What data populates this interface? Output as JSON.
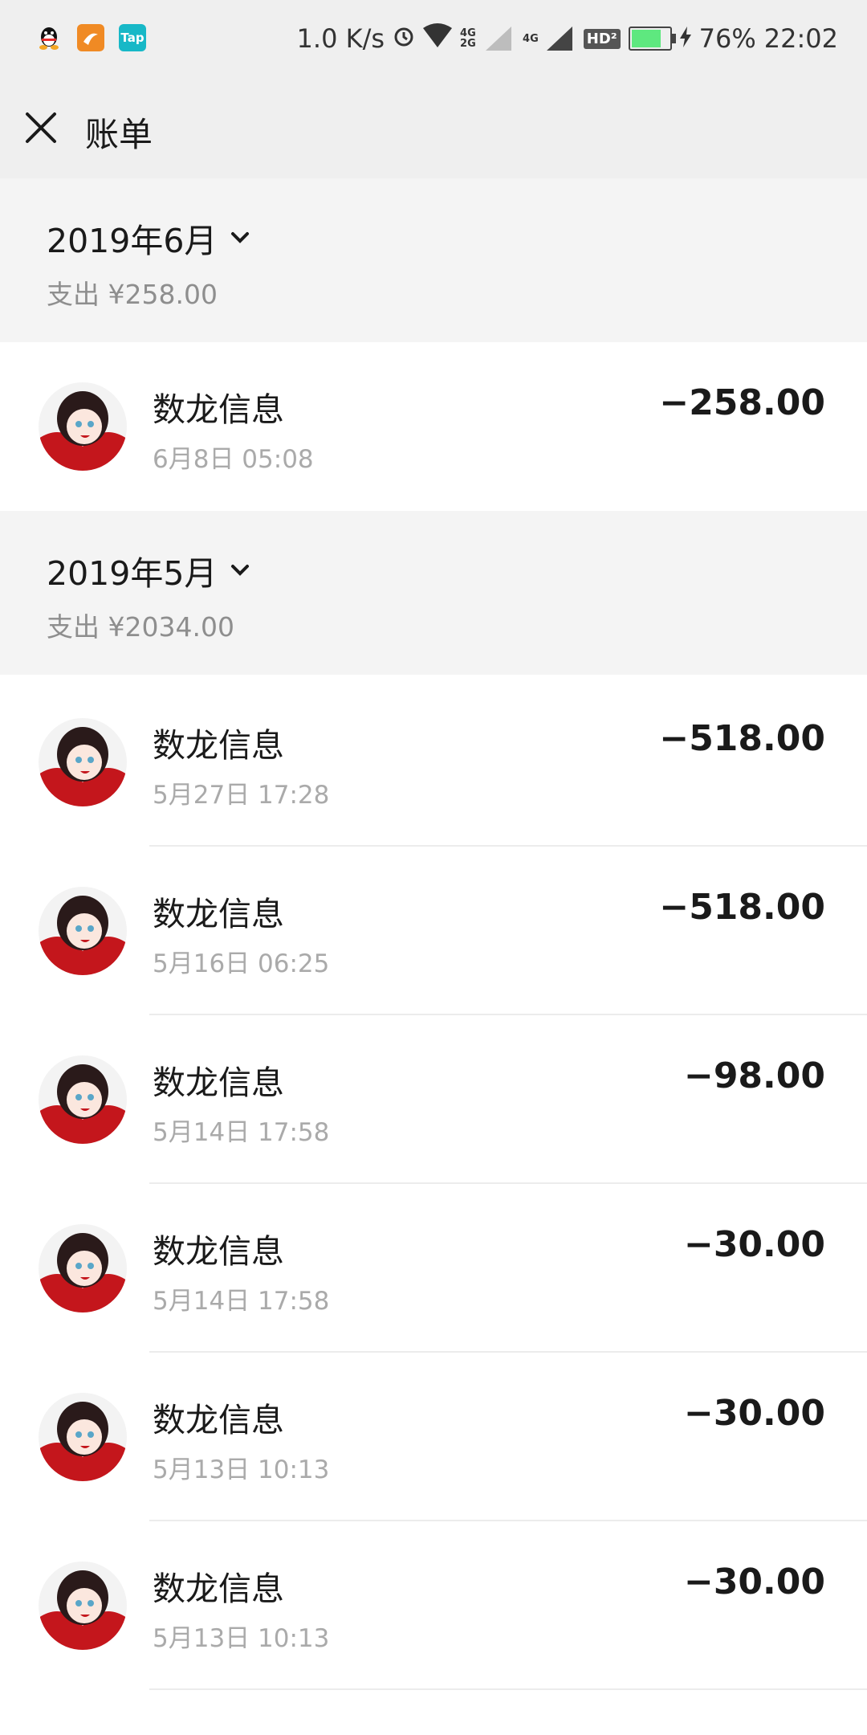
{
  "status_bar": {
    "net_speed": "1.0 K/s",
    "net_4g2g": "4G 2G",
    "net_4g": "4G",
    "hd": "HD²",
    "battery": "76%",
    "time": "22:02",
    "app_icons": [
      "qq-icon",
      "orange-app-icon",
      "tap-icon"
    ],
    "tap_label": "Tap"
  },
  "header": {
    "title": "账单"
  },
  "sections": [
    {
      "month": "2019年6月",
      "summary": "支出 ¥258.00",
      "items": [
        {
          "name": "数龙信息",
          "time": "6月8日 05:08",
          "amount": "−258.00"
        }
      ]
    },
    {
      "month": "2019年5月",
      "summary": "支出 ¥2034.00",
      "items": [
        {
          "name": "数龙信息",
          "time": "5月27日 17:28",
          "amount": "−518.00"
        },
        {
          "name": "数龙信息",
          "time": "5月16日 06:25",
          "amount": "−518.00"
        },
        {
          "name": "数龙信息",
          "time": "5月14日 17:58",
          "amount": "−98.00"
        },
        {
          "name": "数龙信息",
          "time": "5月14日 17:58",
          "amount": "−30.00"
        },
        {
          "name": "数龙信息",
          "time": "5月13日 10:13",
          "amount": "−30.00"
        },
        {
          "name": "数龙信息",
          "time": "5月13日 10:13",
          "amount": "−30.00"
        }
      ]
    }
  ],
  "colors": {
    "header_bg": "#efefef",
    "month_bg": "#f4f4f4",
    "avatar_red": "#c4161c"
  }
}
